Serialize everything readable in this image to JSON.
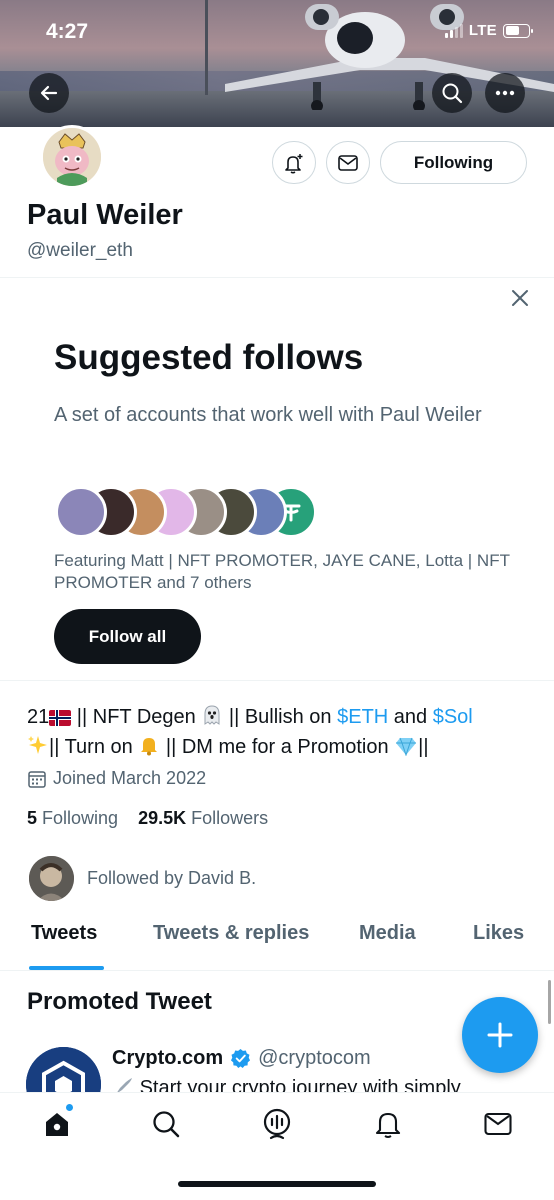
{
  "status_bar": {
    "time": "4:27",
    "network": "LTE"
  },
  "colors": {
    "accent": "#1d9bf0",
    "text": "#0f1419",
    "muted": "#536471",
    "border": "#cfd9de"
  },
  "header_icons": {
    "back": "arrow-left-icon",
    "search": "search-icon",
    "more": "more-icon"
  },
  "profile": {
    "name": "Paul Weiler",
    "handle": "@weiler_eth",
    "following_button": "Following",
    "bio_parts": {
      "p1": "21",
      "p2": " || NFT Degen ",
      "p3": " || Bullish on ",
      "eth": "$ETH",
      "and": " and ",
      "sol": "$Sol",
      "p4": "|| Turn on ",
      "p5": " || DM me for a Promotion ",
      "p6": "||"
    },
    "joined": "Joined March 2022",
    "following_count": "5",
    "following_label": "Following",
    "followers_count": "29.5K",
    "followers_label": "Followers",
    "followed_by": "Followed by David B."
  },
  "suggested": {
    "title": "Suggested follows",
    "description": "A set of accounts that work well with Paul Weiler",
    "featuring": "Featuring Matt | NFT PROMOTER, JAYE CANE, Lotta | NFT PROMOTER and 7 others",
    "follow_all": "Follow all"
  },
  "tabs": [
    {
      "label": "Tweets",
      "active": true
    },
    {
      "label": "Tweets & replies",
      "active": false
    },
    {
      "label": "Media",
      "active": false
    },
    {
      "label": "Likes",
      "active": false
    }
  ],
  "promoted": {
    "heading": "Promoted Tweet",
    "account_name": "Crypto.com",
    "account_handle": "@cryptocom",
    "text": "Start your crypto journey with simply"
  },
  "bottom_nav": [
    "home-icon",
    "search-icon",
    "spaces-icon",
    "notifications-icon",
    "messages-icon"
  ]
}
